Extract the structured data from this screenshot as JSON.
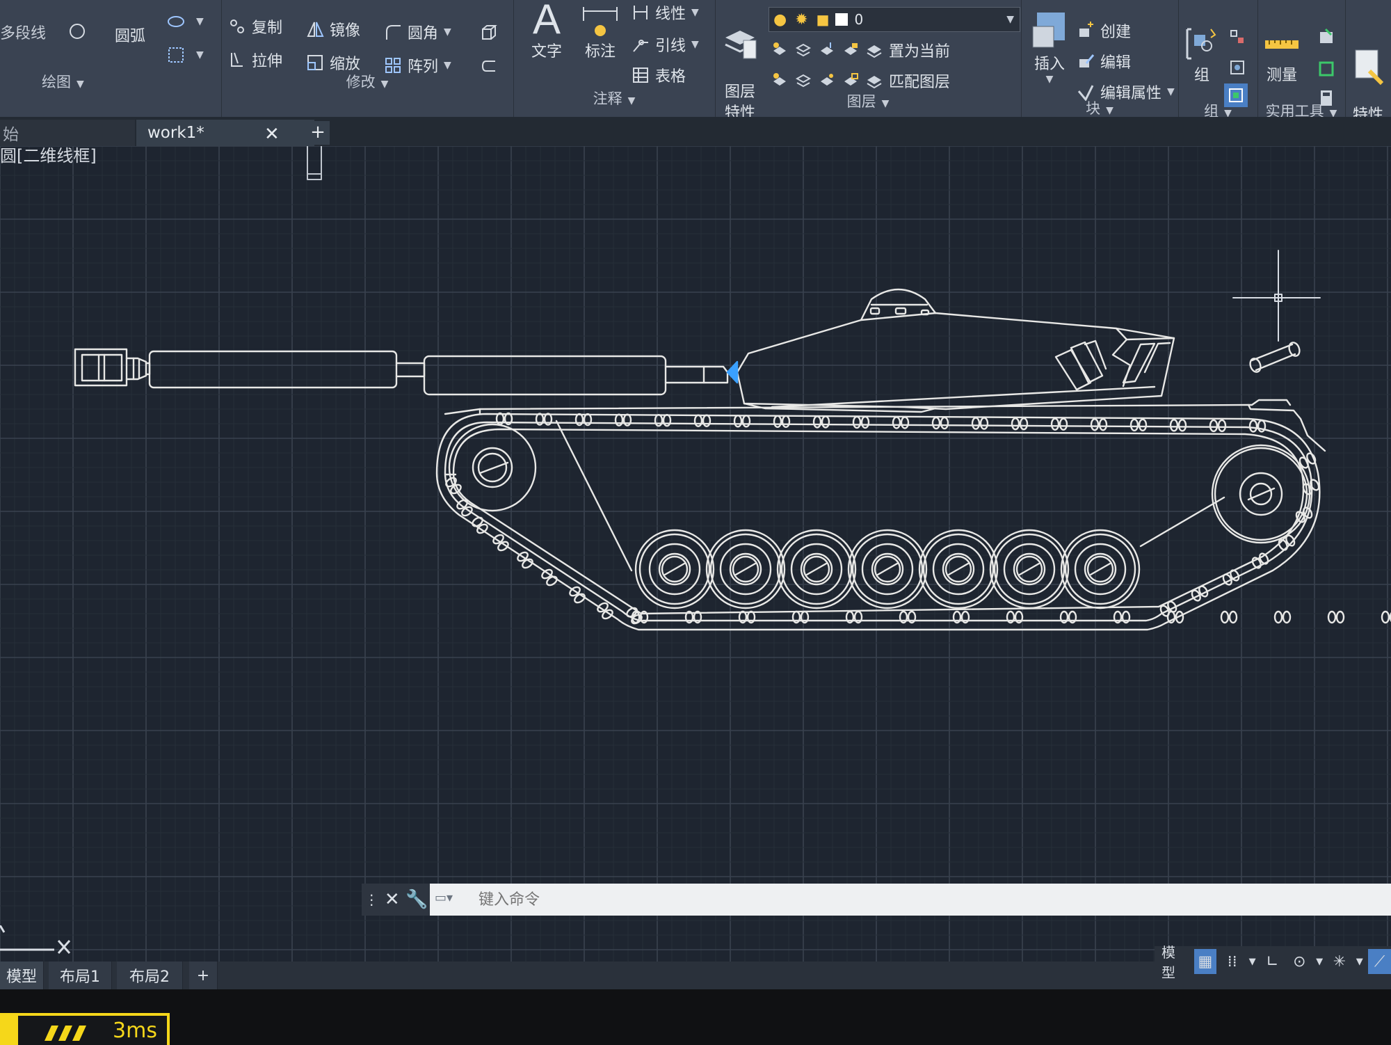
{
  "ribbon": {
    "panels": {
      "draw": {
        "title": "绘图",
        "items": {
          "polyline": "多段线",
          "arc": "圆弧"
        }
      },
      "modify": {
        "title": "修改",
        "items": {
          "copy": "复制",
          "mirror": "镜像",
          "fillet": "圆角",
          "stretch": "拉伸",
          "scale": "缩放",
          "array": "阵列"
        }
      },
      "annotation": {
        "title": "注释",
        "items": {
          "text": "文字",
          "dimension": "标注",
          "linetype": "线性",
          "leader": "引线",
          "table": "表格"
        }
      },
      "layers": {
        "title": "图层",
        "items": {
          "layer_properties": "图层\n特性",
          "set_current": "置为当前",
          "match_layer": "匹配图层"
        },
        "current_layer": "0"
      },
      "block": {
        "title": "块",
        "items": {
          "insert": "插入",
          "create": "创建",
          "edit": "编辑",
          "edit_attributes": "编辑属性"
        }
      },
      "groups": {
        "title": "组",
        "items": {
          "group": "组"
        }
      },
      "utilities": {
        "title": "实用工具",
        "items": {
          "measure": "测量"
        }
      },
      "properties": {
        "items": {
          "match_properties": "特性\n匹配"
        }
      }
    }
  },
  "tabs": {
    "start": "始",
    "document": "work1*",
    "close": "✕",
    "new": "+"
  },
  "viewport": {
    "label": "[俯视][二维线框]",
    "visible_label": "圆[二维线框]"
  },
  "command": {
    "placeholder": "键入命令"
  },
  "layout_tabs": [
    "模型",
    "布局1",
    "布局2"
  ],
  "layout_add": "+",
  "status": {
    "model": "模型"
  },
  "osd": {
    "value": "3ms"
  },
  "colors": {
    "canvas": "#1e2530",
    "grid_major": "#39424f",
    "grid_minor": "#262e39",
    "drawing_lines": "#e8e8e6",
    "ribbon": "#3a4352",
    "accent": "#4a7fc4",
    "osd_yellow": "#f5d71a"
  },
  "icons": [
    "polyline-icon",
    "ellipse-icon",
    "copy-icon",
    "mirror-icon",
    "fillet-icon",
    "stretch-icon",
    "scale-icon",
    "array-icon",
    "text-icon",
    "dimension-icon",
    "leader-icon",
    "table-icon",
    "lightbulb-icon",
    "sun-icon",
    "lock-icon",
    "layers-icon",
    "insert-block-icon",
    "create-block-icon",
    "edit-block-icon",
    "edit-attributes-icon",
    "group-icon",
    "measure-icon",
    "calculator-icon",
    "match-properties-icon",
    "close-icon",
    "wrench-icon",
    "grid-icon",
    "snap-icon"
  ]
}
